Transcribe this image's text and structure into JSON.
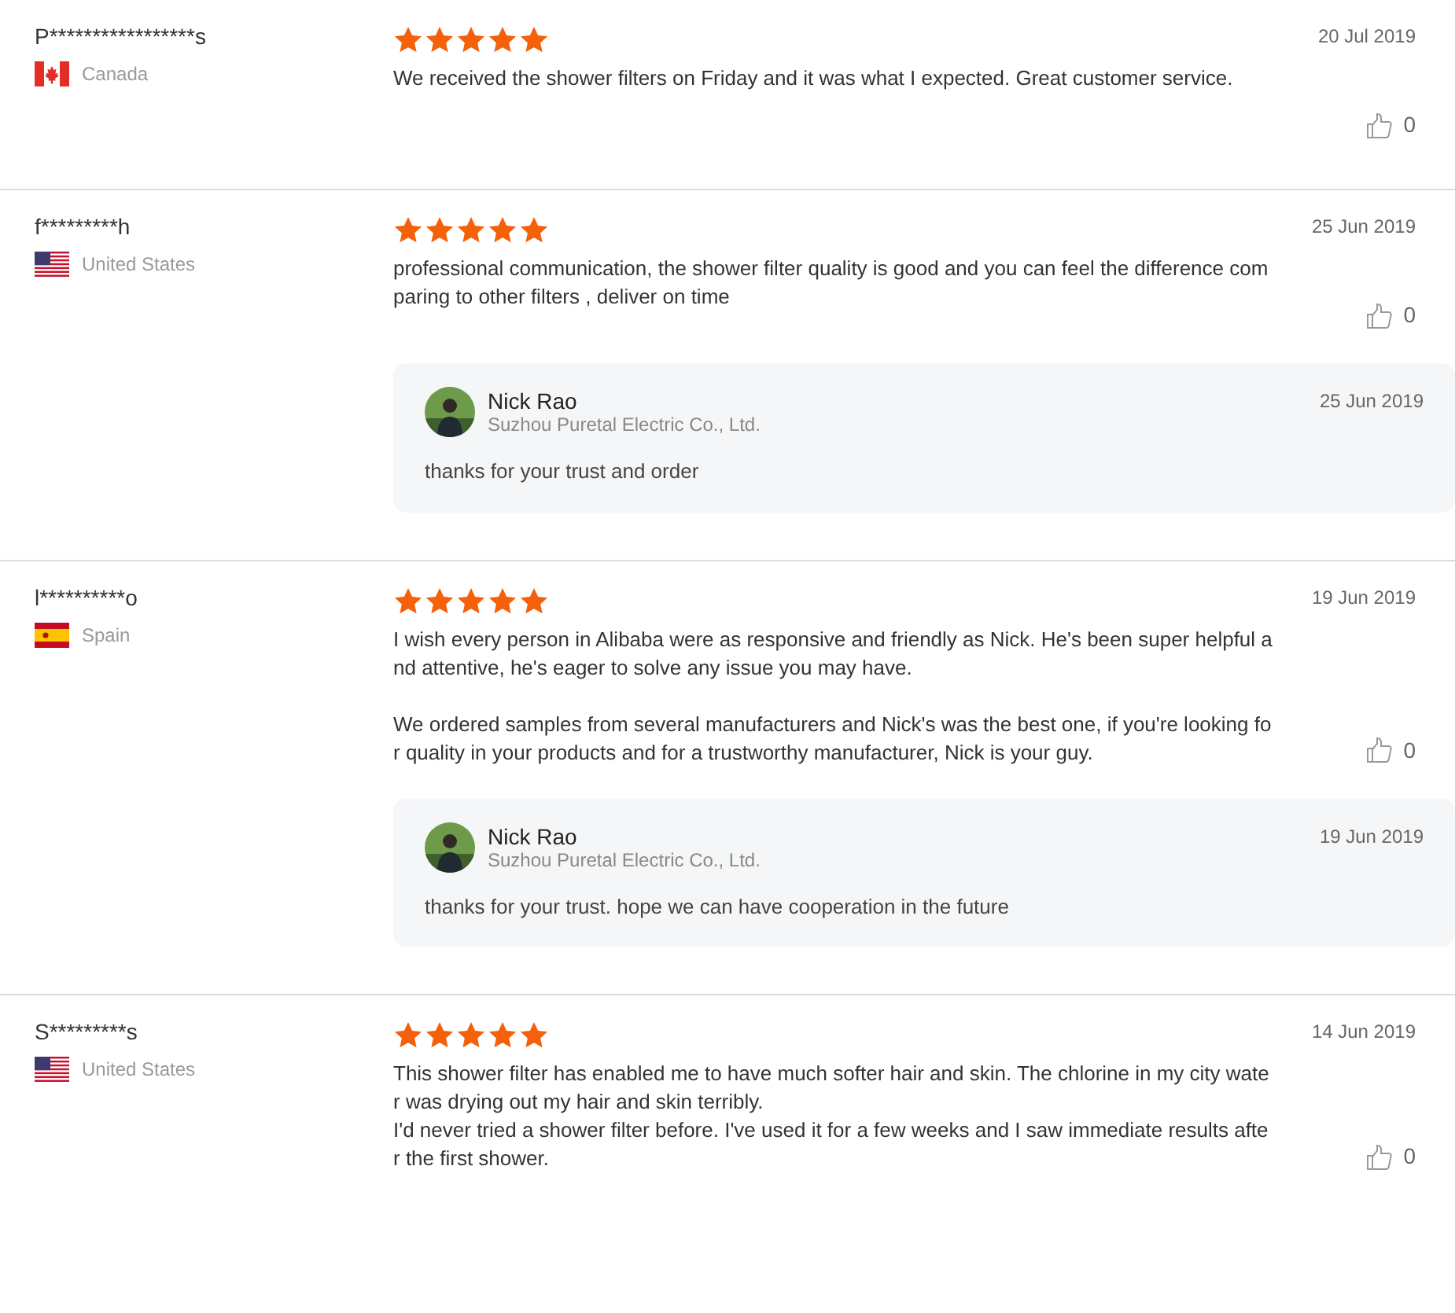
{
  "reviews": [
    {
      "buyer": "P*****************s",
      "country": {
        "name": "Canada",
        "kind": "ca"
      },
      "stars": 5,
      "date": "20 Jul 2019",
      "paragraphs": [
        "We received the shower filters on Friday and it was what I expected. Great customer service."
      ],
      "likes": "0"
    },
    {
      "buyer": "f*********h",
      "country": {
        "name": "United States",
        "kind": "us"
      },
      "stars": 5,
      "date": "25 Jun 2019",
      "paragraphs": [
        "professional communication, the shower filter quality is good and you can feel the difference comparing to other filters , deliver on time"
      ],
      "likes": "0",
      "reply": {
        "name": "Nick Rao",
        "company": "Suzhou Puretal Electric Co., Ltd.",
        "date": "25 Jun 2019",
        "text": "thanks for your trust and order"
      }
    },
    {
      "buyer": "l**********o",
      "country": {
        "name": "Spain",
        "kind": "es"
      },
      "stars": 5,
      "date": "19 Jun 2019",
      "paragraphs": [
        "I wish every person in Alibaba were as responsive and friendly as Nick. He's been super helpful and attentive, he's eager to solve any issue you may have.",
        "We ordered samples from several manufacturers and Nick's was the best one, if you're looking for quality in your products and for a trustworthy manufacturer, Nick is your guy."
      ],
      "likes": "0",
      "reply": {
        "name": "Nick Rao",
        "company": "Suzhou Puretal Electric Co., Ltd.",
        "date": "19 Jun 2019",
        "text": "thanks for your trust. hope we can have cooperation in the future"
      }
    },
    {
      "buyer": "S*********s",
      "country": {
        "name": "United States",
        "kind": "us"
      },
      "stars": 5,
      "date": "14 Jun 2019",
      "paragraphs": [
        "This shower filter has enabled me to have much softer hair and skin. The chlorine in my city water was drying out my hair and skin terribly.\nI'd never tried a shower filter before. I've used it for a few weeks and I saw immediate results after the first shower."
      ],
      "likes": "0"
    }
  ]
}
